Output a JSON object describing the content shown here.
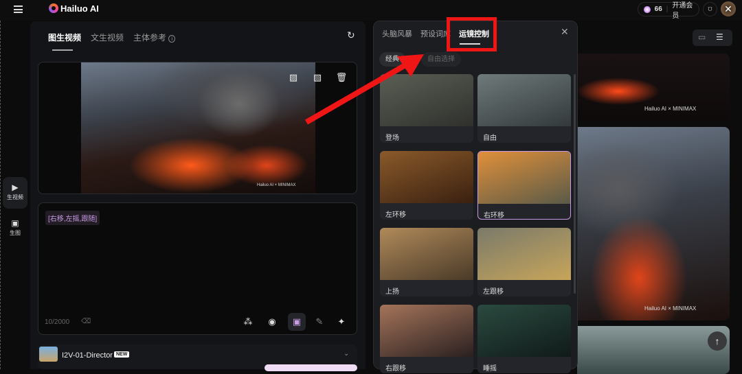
{
  "header": {
    "brand": "Hailuo AI",
    "credits": "66",
    "membership": "开通会员"
  },
  "rail": [
    {
      "label": "生视频"
    },
    {
      "label": "生图"
    }
  ],
  "panel": {
    "tabs": [
      "图生视频",
      "文生视频",
      "主体参考"
    ],
    "watermark": "Hailuo AI × MINIMAX",
    "prompt_chip": "[右移,左摇,跟随]",
    "char_count": "10/2000",
    "model_name": "I2V-01-Director",
    "model_badge": "NEW"
  },
  "popup": {
    "tabs": [
      "头脑风暴",
      "预设词库",
      "运镜控制"
    ],
    "segments": [
      "经典",
      "自由选择"
    ],
    "items": [
      {
        "label": "登场",
        "colors": [
          "#5a5f55",
          "#2f302c"
        ]
      },
      {
        "label": "自由",
        "colors": [
          "#6f7a7a",
          "#33393a"
        ]
      },
      {
        "label": "左环移",
        "colors": [
          "#8a5a2a",
          "#3a2010"
        ]
      },
      {
        "label": "右环移",
        "colors": [
          "#e0903a",
          "#5a5a48"
        ],
        "selected": true
      },
      {
        "label": "上扬",
        "colors": [
          "#b08a5a",
          "#4a3a28"
        ]
      },
      {
        "label": "左跟移",
        "colors": [
          "#7a7a6a",
          "#c7a55a"
        ]
      },
      {
        "label": "右跟移",
        "colors": [
          "#a5745a",
          "#2a2020"
        ]
      },
      {
        "label": "睡摇",
        "colors": [
          "#2a4a40",
          "#101a18"
        ]
      }
    ]
  },
  "gallery": {
    "watermark": "Hailuo AI × MINIMAX"
  }
}
